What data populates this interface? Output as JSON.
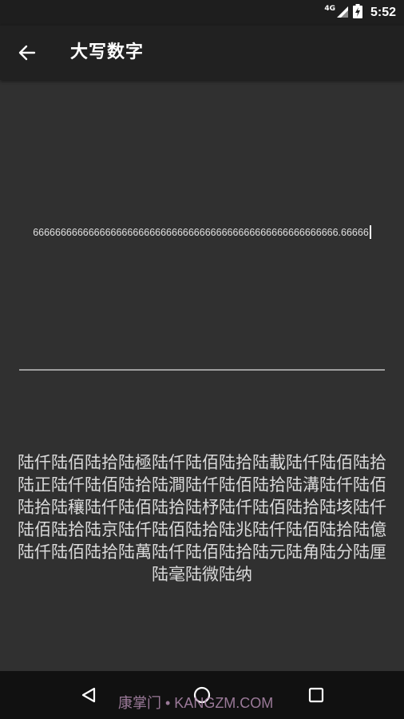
{
  "status_bar": {
    "network": "4G",
    "time": "5:52"
  },
  "app_bar": {
    "title": "大写数字",
    "back_icon": "arrow-left-icon"
  },
  "input": {
    "value": "6666666666666666666666666666666666666666666666666666666.66666"
  },
  "result": {
    "text": "陆仟陆佰陆拾陆極陆仟陆佰陆拾陆載陆仟陆佰陆拾陆正陆仟陆佰陆拾陆澗陆仟陆佰陆拾陆溝陆仟陆佰陆拾陆穰陆仟陆佰陆拾陆杼陆仟陆佰陆拾陆垓陆仟陆佰陆拾陆京陆仟陆佰陆拾陆兆陆仟陆佰陆拾陆億陆仟陆佰陆拾陆萬陆仟陆佰陆拾陆元陆角陆分陆厘陆毫陆微陆纳"
  },
  "nav_bar": {
    "back_icon": "nav-back-icon",
    "home_icon": "nav-home-icon",
    "recents_icon": "nav-recents-icon"
  },
  "watermark": {
    "text": "康掌门 • KANGZM.COM"
  }
}
